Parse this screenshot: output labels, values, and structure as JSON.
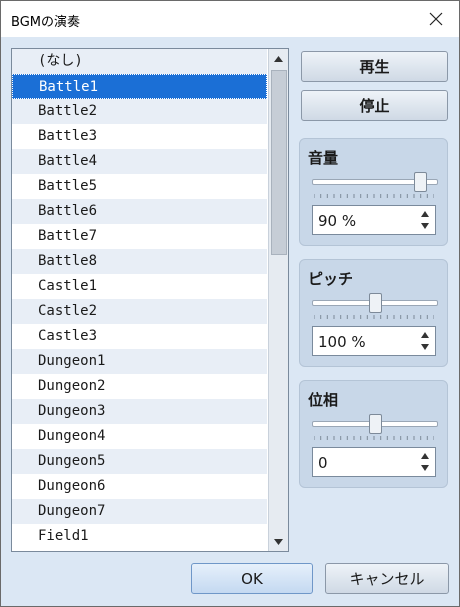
{
  "window": {
    "title": "BGMの演奏"
  },
  "list": {
    "items": [
      "(なし)",
      "Battle1",
      "Battle2",
      "Battle3",
      "Battle4",
      "Battle5",
      "Battle6",
      "Battle7",
      "Battle8",
      "Castle1",
      "Castle2",
      "Castle3",
      "Dungeon1",
      "Dungeon2",
      "Dungeon3",
      "Dungeon4",
      "Dungeon5",
      "Dungeon6",
      "Dungeon7",
      "Field1"
    ],
    "selected_index": 1
  },
  "buttons": {
    "play": "再生",
    "stop": "停止",
    "ok": "OK",
    "cancel": "キャンセル"
  },
  "volume": {
    "label": "音量",
    "value": "90 %",
    "level": 90
  },
  "pitch": {
    "label": "ピッチ",
    "value": "100 %",
    "level": 50
  },
  "pan": {
    "label": "位相",
    "value": "0",
    "level": 50
  },
  "icons": {
    "close": "close-icon",
    "scroll_up": "scroll-up-arrow-icon",
    "scroll_down": "scroll-down-arrow-icon",
    "spin_up": "spin-up-icon",
    "spin_down": "spin-down-icon"
  },
  "colors": {
    "selection": "#1b6fd6",
    "alt_row": "#e8eef6",
    "background": "#dbe7f4"
  }
}
